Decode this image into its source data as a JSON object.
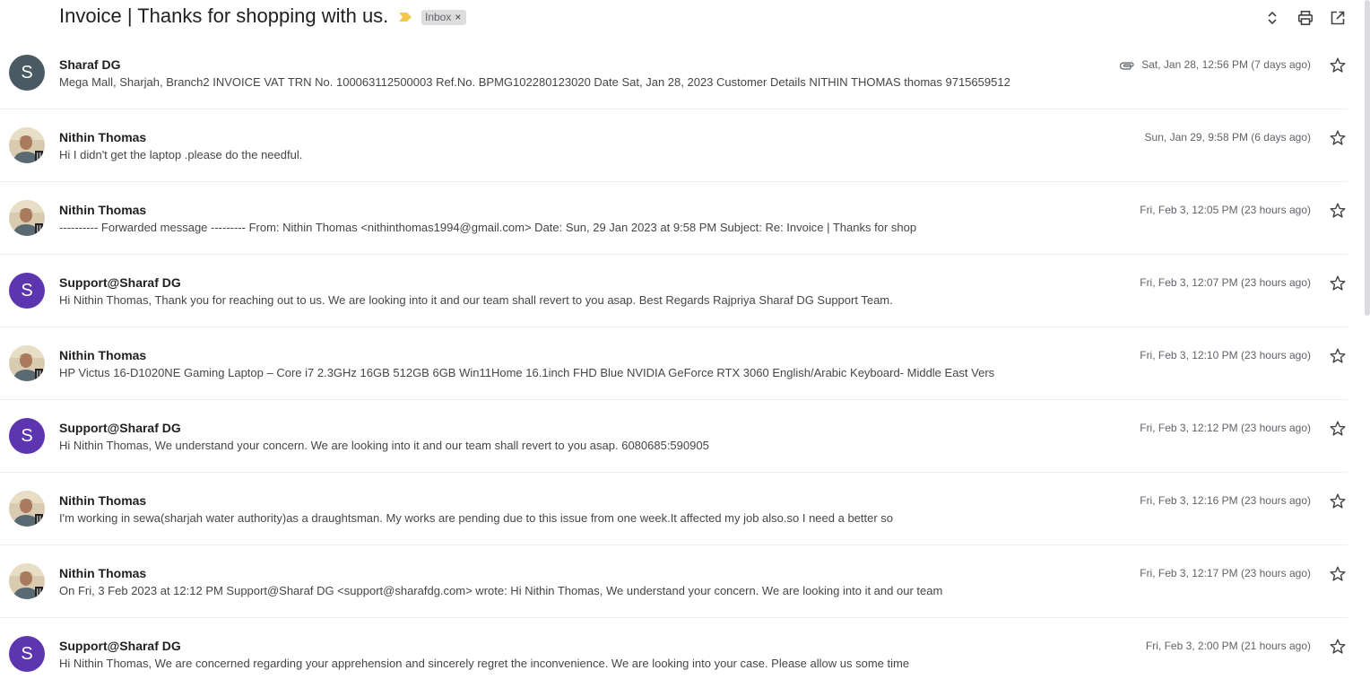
{
  "header": {
    "subject": "Invoice | Thanks for shopping with us.",
    "label": "Inbox",
    "label_remove": "×",
    "icons": [
      "expand-collapse-icon",
      "print-icon",
      "open-in-new-window-icon"
    ]
  },
  "colors": {
    "important_marker": "#f2c94c",
    "avatar_grey": "#4a5a63",
    "avatar_purple": "#5e35b1",
    "divider": "#eceff1"
  },
  "messages": [
    {
      "sender": "Sharaf DG",
      "avatar": "S",
      "avatar_type": "letter-grey",
      "attachment": true,
      "snippet": "Mega Mall, Sharjah, Branch2 INVOICE VAT TRN No. 100063112500003 Ref.No. BPMG102280123020 Date Sat, Jan 28, 2023 Customer Details NITHIN THOMAS thomas 9715659512",
      "date": "Sat, Jan 28, 12:56 PM (7 days ago)"
    },
    {
      "sender": "Nithin Thomas",
      "avatar": "",
      "avatar_type": "photo",
      "attachment": false,
      "snippet": "Hi I didn't get the laptop .please do the needful.",
      "date": "Sun, Jan 29, 9:58 PM (6 days ago)"
    },
    {
      "sender": "Nithin Thomas",
      "avatar": "",
      "avatar_type": "photo",
      "attachment": false,
      "snippet": "---------- Forwarded message --------- From: Nithin Thomas <nithinthomas1994@gmail.com> Date: Sun, 29 Jan 2023 at 9:58 PM Subject: Re: Invoice | Thanks for shop",
      "date": "Fri, Feb 3, 12:05 PM (23 hours ago)"
    },
    {
      "sender": "Support@Sharaf DG",
      "avatar": "S",
      "avatar_type": "letter-purple",
      "attachment": false,
      "snippet": "Hi Nithin Thomas, Thank you for reaching out to us. We are looking into it and our team shall revert to you asap. Best Regards Rajpriya Sharaf DG Support Team.",
      "date": "Fri, Feb 3, 12:07 PM (23 hours ago)"
    },
    {
      "sender": "Nithin Thomas",
      "avatar": "",
      "avatar_type": "photo",
      "attachment": false,
      "snippet": "HP Victus 16-D1020NE Gaming Laptop – Core i7 2.3GHz 16GB 512GB 6GB Win11Home 16.1inch FHD Blue NVIDIA GeForce RTX 3060 English/Arabic Keyboard- Middle East Vers",
      "date": "Fri, Feb 3, 12:10 PM (23 hours ago)"
    },
    {
      "sender": "Support@Sharaf DG",
      "avatar": "S",
      "avatar_type": "letter-purple",
      "attachment": false,
      "snippet": "Hi Nithin Thomas, We understand your concern. We are looking into it and our team shall revert to you asap. 6080685:590905",
      "date": "Fri, Feb 3, 12:12 PM (23 hours ago)"
    },
    {
      "sender": "Nithin Thomas",
      "avatar": "",
      "avatar_type": "photo",
      "attachment": false,
      "snippet": "I'm working in sewa(sharjah water authority)as a draughtsman. My works are pending due to this issue from one week.It affected my job also.so I need a better so",
      "date": "Fri, Feb 3, 12:16 PM (23 hours ago)"
    },
    {
      "sender": "Nithin Thomas",
      "avatar": "",
      "avatar_type": "photo",
      "attachment": false,
      "snippet": "On Fri, 3 Feb 2023 at 12:12 PM Support@Sharaf DG <support@sharafdg.com> wrote: Hi Nithin Thomas, We understand your concern. We are looking into it and our team",
      "date": "Fri, Feb 3, 12:17 PM (23 hours ago)"
    },
    {
      "sender": "Support@Sharaf DG",
      "avatar": "S",
      "avatar_type": "letter-purple",
      "attachment": false,
      "snippet": "Hi Nithin Thomas, We are concerned regarding your apprehension and sincerely regret the inconvenience. We are looking into your case. Please allow us some time",
      "date": "Fri, Feb 3, 2:00 PM (21 hours ago)"
    }
  ]
}
